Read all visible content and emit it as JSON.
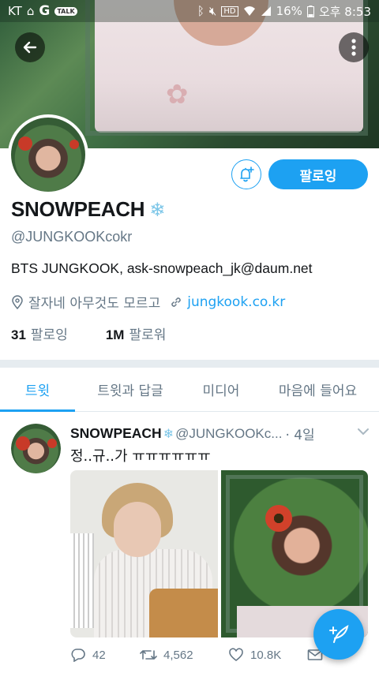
{
  "status_bar": {
    "carrier": "KT",
    "g_label": "G",
    "talk_label": "TALK",
    "hd_label": "HD",
    "battery": "16%",
    "time": "오후 8:53"
  },
  "profile": {
    "display_name": "SNOWPEACH",
    "badge_glyph": "❄",
    "handle": "@JUNGKOOKcokr",
    "bio": "BTS JUNGKOOK,  ask-snowpeach_jk@daum.net",
    "location": "잘자네 아무것도 모르고",
    "website": "jungkook.co.kr",
    "following_count": "31",
    "following_label": "팔로잉",
    "followers_count": "1M",
    "followers_label": "팔로워",
    "follow_button": "팔로잉"
  },
  "tabs": [
    {
      "label": "트윗",
      "active": true
    },
    {
      "label": "트윗과 답글",
      "active": false
    },
    {
      "label": "미디어",
      "active": false
    },
    {
      "label": "마음에 들어요",
      "active": false
    }
  ],
  "tweet": {
    "author_name": "SNOWPEACH",
    "author_badge": "❄",
    "author_handle": "@JUNGKOOKc...",
    "time": "· 4일",
    "text": "정..규..가 ㅠㅠㅠㅠㅠㅠ",
    "replies": "42",
    "retweets": "4,562",
    "likes": "10.8K"
  },
  "colors": {
    "accent": "#1da1f2",
    "secondary_text": "#657786",
    "primary_text": "#14171a",
    "badge": "#7cc6e8"
  }
}
